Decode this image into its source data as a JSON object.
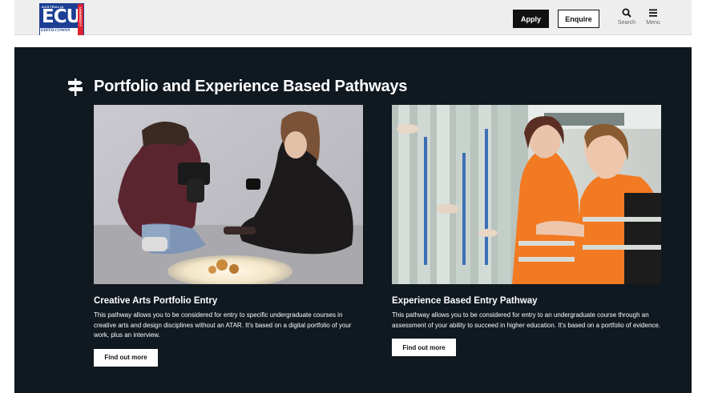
{
  "header": {
    "logo": {
      "top_text": "AUSTRALIA",
      "main_text": "ECU",
      "bottom_text": "EDITH COWAN",
      "side_text": "UNIVERSITY"
    },
    "apply_label": "Apply",
    "enquire_label": "Enquire",
    "search_label": "Search",
    "menu_label": "Menu"
  },
  "section": {
    "title": "Portfolio and Experience Based Pathways",
    "icon": "signpost-icon"
  },
  "cards": [
    {
      "title": "Creative Arts Portfolio Entry",
      "body": "This pathway allows you to be considered for entry to specific undergraduate courses in creative arts and design disciplines without an ATAR. It's based on a digital portfolio of your work, plus an interview.",
      "button_label": "Find out more"
    },
    {
      "title": "Experience Based Entry Pathway",
      "body": "This pathway allows you to be considered for entry to an undergraduate course through an assessment of your ability to succeed in higher education. It's based on a portfolio of evidence.",
      "button_label": "Find out more"
    }
  ],
  "colors": {
    "brand_blue": "#1c3f94",
    "brand_red": "#e0242f",
    "dark_background": "#101820",
    "header_background": "#eeeeee"
  }
}
